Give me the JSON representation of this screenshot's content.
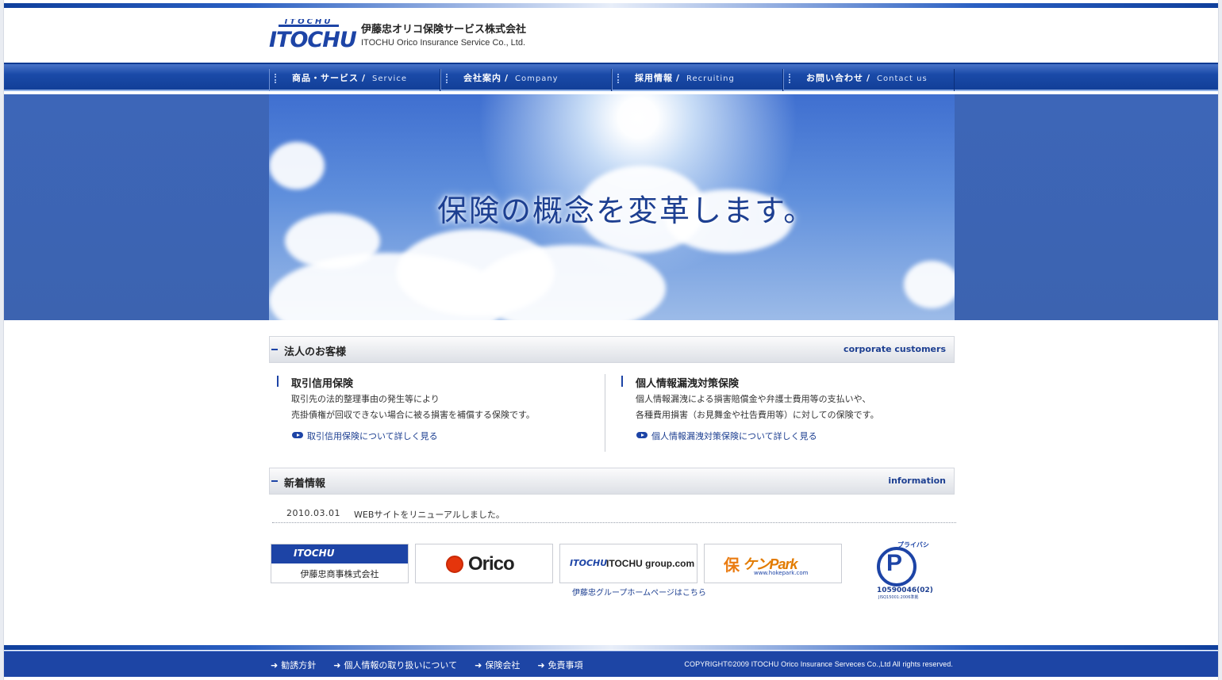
{
  "header": {
    "logo_top": "ITOCHU",
    "logo_main": "ITOCHU",
    "company_jp": "伊藤忠オリコ保険サービス株式会社",
    "company_en": "ITOCHU Orico Insurance Service Co., Ltd."
  },
  "nav": [
    {
      "jp": "商品・サービス",
      "en": "Service"
    },
    {
      "jp": "会社案内",
      "en": "Company"
    },
    {
      "jp": "採用情報",
      "en": "Recruiting"
    },
    {
      "jp": "お問い合わせ",
      "en": "Contact us"
    }
  ],
  "nav_sep": "/",
  "hero": {
    "tagline": "保険の概念を変革します。"
  },
  "corporate": {
    "title_jp": "法人のお客様",
    "title_en": "corporate customers",
    "products": [
      {
        "title": "取引信用保険",
        "desc_line1": "取引先の法的整理事由の発生等により",
        "desc_line2": "売掛債権が回収できない場合に被る損害を補償する保険です。",
        "link": "取引信用保険について詳しく見る"
      },
      {
        "title": "個人情報漏洩対策保険",
        "desc_line1": "個人情報漏洩による損害賠償金や弁護士費用等の支払いや、",
        "desc_line2": "各種費用損害（お見舞金や社告費用等）に対しての保険です。",
        "link": "個人情報漏洩対策保険について詳しく見る"
      }
    ]
  },
  "news": {
    "title_jp": "新着情報",
    "title_en": "information",
    "items": [
      {
        "date": "2010.03.01",
        "text": "WEBサイトをリニューアルしました。"
      }
    ]
  },
  "banners": {
    "itochu_mini": "ITOCHU",
    "itochu_label": "伊藤忠商事株式会社",
    "orico": "Orico",
    "group_mini": "ITOCHU",
    "group_word": "ITOCHU group.com",
    "group_caption": "伊藤忠グループホームページはこちら",
    "hoken_ho": "保",
    "hoken_word": "ケンPark",
    "hoken_sub": "www.hokepark.com",
    "privacy_tag": "プライバシー",
    "privacy_code": "10590046(02)",
    "privacy_sub": "JISQ15001:2006準拠"
  },
  "footer": {
    "links": [
      "勧誘方針",
      "個人情報の取り扱いについて",
      "保険会社",
      "免責事項"
    ],
    "arrow": "➜",
    "copyright": "COPYRIGHT©2009 ITOCHU Orico Insurance Serveces Co.,Ltd All rights reserved."
  },
  "colors": {
    "brand_blue": "#1d44a6",
    "orico_red": "#e5350c",
    "hoken_orange": "#e27b00"
  }
}
